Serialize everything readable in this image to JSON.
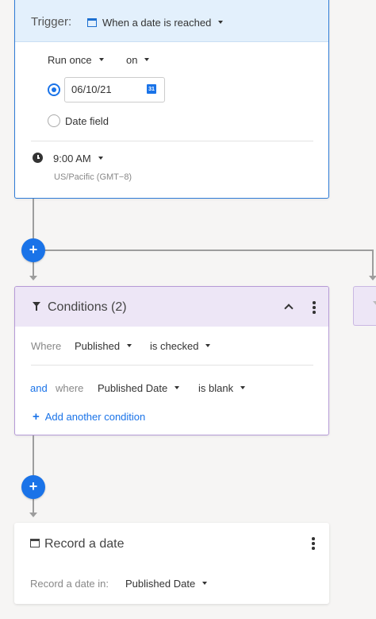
{
  "trigger": {
    "label": "Trigger:",
    "type_value": "When a date is reached",
    "frequency": "Run once",
    "on_option": "on",
    "date_value": "06/10/21",
    "date_icon_text": "31",
    "date_field_label": "Date field",
    "time_value": "9:00 AM",
    "timezone": "US/Pacific (GMT−8)"
  },
  "add_step_label": "+",
  "conditions": {
    "title": "Conditions (2)",
    "rows": [
      {
        "prefix": "",
        "where": "Where",
        "field": "Published",
        "operator": "is checked"
      },
      {
        "prefix": "and",
        "where": "where",
        "field": "Published Date",
        "operator": "is blank"
      }
    ],
    "add_condition_plus": "+",
    "add_condition_label": "Add another condition"
  },
  "record_action": {
    "title": "Record a date",
    "field_label": "Record a date in:",
    "field_value": "Published Date"
  },
  "colors": {
    "accent": "#1a73e8",
    "trigger_header": "#e3f0fc",
    "trigger_border": "#2d7bd6",
    "conditions_header": "#ede6f6",
    "conditions_border": "#b59ad6",
    "connector": "#9d9d9d",
    "background": "#f6f5f4"
  },
  "icons": {
    "trigger_type": "calendar-icon",
    "date_picker": "calendar-31-icon",
    "time": "clock-icon",
    "conditions": "filter-icon",
    "collapse": "chevron-up-icon",
    "menu": "kebab-menu-icon",
    "record": "calendar-icon",
    "add": "plus-icon"
  }
}
